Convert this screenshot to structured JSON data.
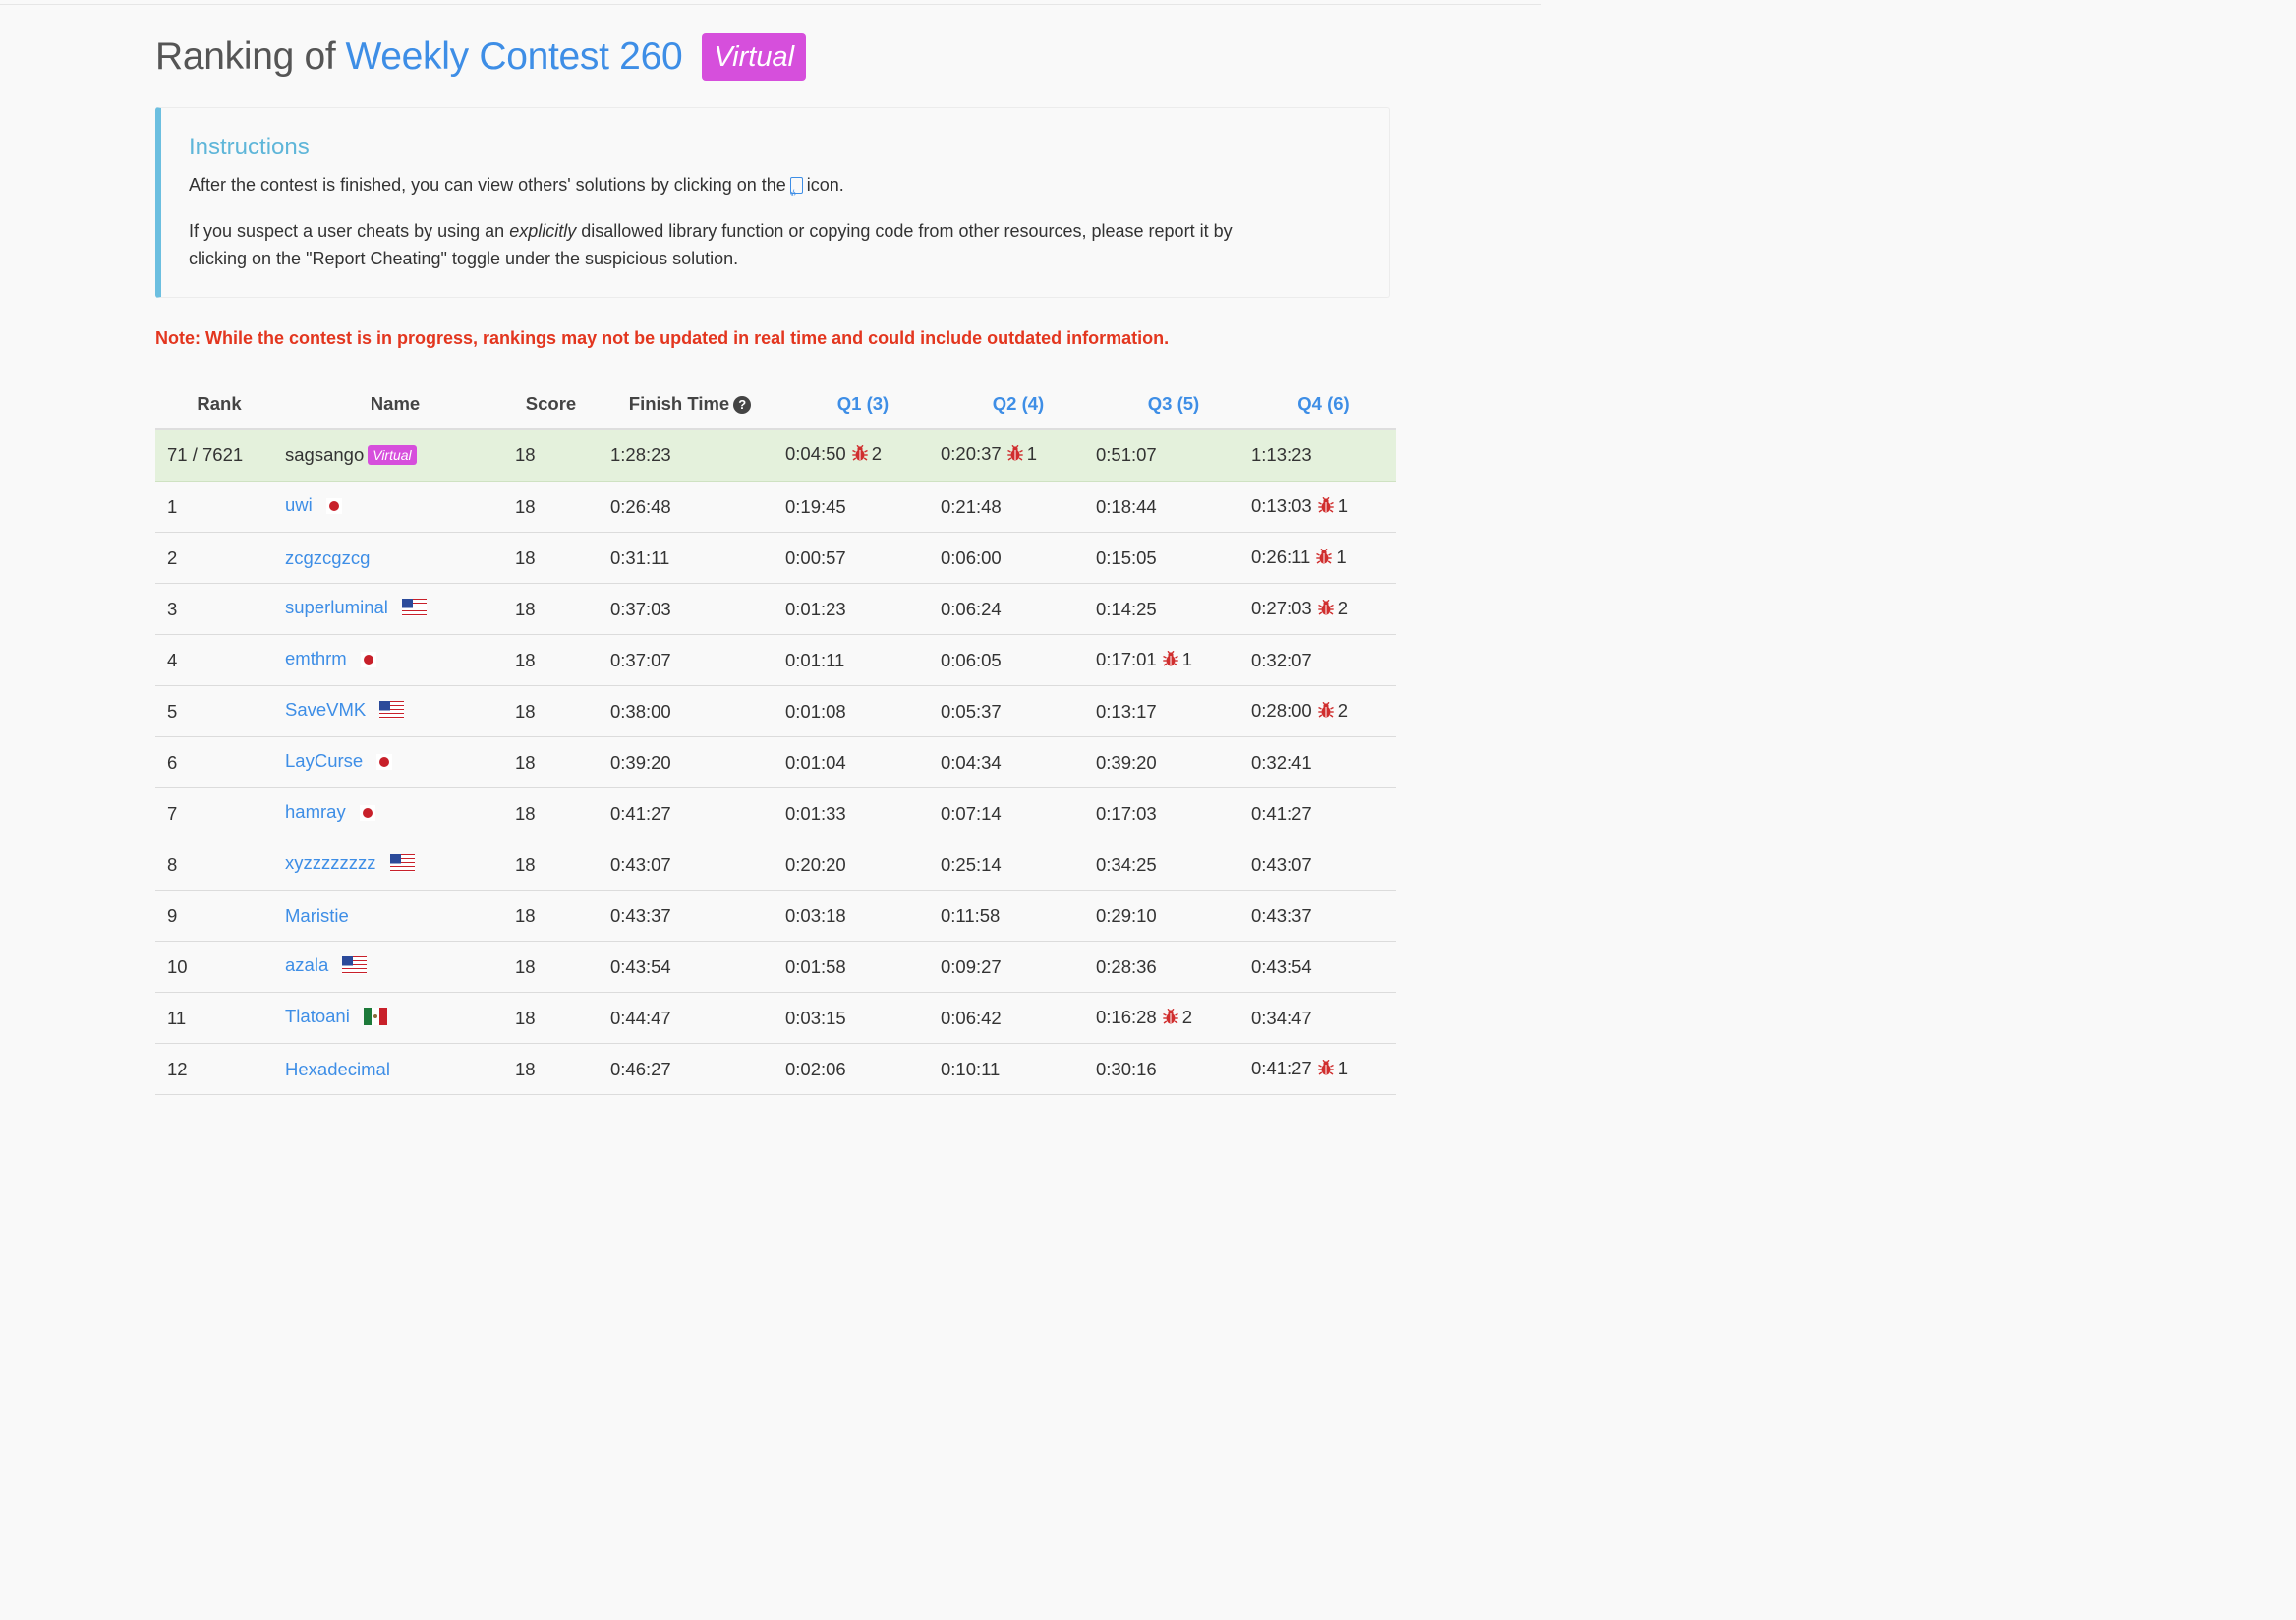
{
  "header": {
    "title_prefix": "Ranking of",
    "contest_name": "Weekly Contest 260",
    "virtual_badge": "Virtual"
  },
  "instructions": {
    "heading": "Instructions",
    "line1_before": "After the contest is finished, you can view others' solutions by clicking on the",
    "line1_after": "icon.",
    "line2_before": "If you suspect a user cheats by using an",
    "line2_emph": "explicitly",
    "line2_after": "disallowed library function or copying code from other resources, please report it by clicking on the \"Report Cheating\" toggle under the suspicious solution."
  },
  "note": "Note: While the contest is in progress, rankings may not be updated in real time and could include outdated information.",
  "table": {
    "headers": {
      "rank": "Rank",
      "name": "Name",
      "score": "Score",
      "finish_time": "Finish Time",
      "q1": "Q1 (3)",
      "q2": "Q2 (4)",
      "q3": "Q3 (5)",
      "q4": "Q4 (6)"
    },
    "rows": [
      {
        "rank": "71 / 7621",
        "name": "sagsango",
        "virtual": "Virtual",
        "flag": "",
        "score": "18",
        "finish": "1:28:23",
        "q": [
          {
            "t": "0:04:50",
            "bugs": "2"
          },
          {
            "t": "0:20:37",
            "bugs": "1"
          },
          {
            "t": "0:51:07",
            "bugs": ""
          },
          {
            "t": "1:13:23",
            "bugs": ""
          }
        ],
        "me": true
      },
      {
        "rank": "1",
        "name": "uwi",
        "flag": "jp",
        "score": "18",
        "finish": "0:26:48",
        "q": [
          {
            "t": "0:19:45",
            "bugs": ""
          },
          {
            "t": "0:21:48",
            "bugs": ""
          },
          {
            "t": "0:18:44",
            "bugs": ""
          },
          {
            "t": "0:13:03",
            "bugs": "1"
          }
        ]
      },
      {
        "rank": "2",
        "name": "zcgzcgzcg",
        "flag": "",
        "score": "18",
        "finish": "0:31:11",
        "q": [
          {
            "t": "0:00:57",
            "bugs": ""
          },
          {
            "t": "0:06:00",
            "bugs": ""
          },
          {
            "t": "0:15:05",
            "bugs": ""
          },
          {
            "t": "0:26:11",
            "bugs": "1"
          }
        ]
      },
      {
        "rank": "3",
        "name": "superluminal",
        "flag": "us",
        "score": "18",
        "finish": "0:37:03",
        "q": [
          {
            "t": "0:01:23",
            "bugs": ""
          },
          {
            "t": "0:06:24",
            "bugs": ""
          },
          {
            "t": "0:14:25",
            "bugs": ""
          },
          {
            "t": "0:27:03",
            "bugs": "2"
          }
        ]
      },
      {
        "rank": "4",
        "name": "emthrm",
        "flag": "jp",
        "score": "18",
        "finish": "0:37:07",
        "q": [
          {
            "t": "0:01:11",
            "bugs": ""
          },
          {
            "t": "0:06:05",
            "bugs": ""
          },
          {
            "t": "0:17:01",
            "bugs": "1"
          },
          {
            "t": "0:32:07",
            "bugs": ""
          }
        ]
      },
      {
        "rank": "5",
        "name": "SaveVMK",
        "flag": "us",
        "score": "18",
        "finish": "0:38:00",
        "q": [
          {
            "t": "0:01:08",
            "bugs": ""
          },
          {
            "t": "0:05:37",
            "bugs": ""
          },
          {
            "t": "0:13:17",
            "bugs": ""
          },
          {
            "t": "0:28:00",
            "bugs": "2"
          }
        ]
      },
      {
        "rank": "6",
        "name": "LayCurse",
        "flag": "jp",
        "score": "18",
        "finish": "0:39:20",
        "q": [
          {
            "t": "0:01:04",
            "bugs": ""
          },
          {
            "t": "0:04:34",
            "bugs": ""
          },
          {
            "t": "0:39:20",
            "bugs": ""
          },
          {
            "t": "0:32:41",
            "bugs": ""
          }
        ]
      },
      {
        "rank": "7",
        "name": "hamray",
        "flag": "jp",
        "score": "18",
        "finish": "0:41:27",
        "q": [
          {
            "t": "0:01:33",
            "bugs": ""
          },
          {
            "t": "0:07:14",
            "bugs": ""
          },
          {
            "t": "0:17:03",
            "bugs": ""
          },
          {
            "t": "0:41:27",
            "bugs": ""
          }
        ]
      },
      {
        "rank": "8",
        "name": "xyzzzzzzzz",
        "flag": "us",
        "score": "18",
        "finish": "0:43:07",
        "q": [
          {
            "t": "0:20:20",
            "bugs": ""
          },
          {
            "t": "0:25:14",
            "bugs": ""
          },
          {
            "t": "0:34:25",
            "bugs": ""
          },
          {
            "t": "0:43:07",
            "bugs": ""
          }
        ]
      },
      {
        "rank": "9",
        "name": "Maristie",
        "flag": "",
        "score": "18",
        "finish": "0:43:37",
        "q": [
          {
            "t": "0:03:18",
            "bugs": ""
          },
          {
            "t": "0:11:58",
            "bugs": ""
          },
          {
            "t": "0:29:10",
            "bugs": ""
          },
          {
            "t": "0:43:37",
            "bugs": ""
          }
        ]
      },
      {
        "rank": "10",
        "name": "azala",
        "flag": "us",
        "score": "18",
        "finish": "0:43:54",
        "q": [
          {
            "t": "0:01:58",
            "bugs": ""
          },
          {
            "t": "0:09:27",
            "bugs": ""
          },
          {
            "t": "0:28:36",
            "bugs": ""
          },
          {
            "t": "0:43:54",
            "bugs": ""
          }
        ]
      },
      {
        "rank": "11",
        "name": "Tlatoani",
        "flag": "mx",
        "score": "18",
        "finish": "0:44:47",
        "q": [
          {
            "t": "0:03:15",
            "bugs": ""
          },
          {
            "t": "0:06:42",
            "bugs": ""
          },
          {
            "t": "0:16:28",
            "bugs": "2"
          },
          {
            "t": "0:34:47",
            "bugs": ""
          }
        ]
      },
      {
        "rank": "12",
        "name": "Hexadecimal",
        "flag": "",
        "score": "18",
        "finish": "0:46:27",
        "q": [
          {
            "t": "0:02:06",
            "bugs": ""
          },
          {
            "t": "0:10:11",
            "bugs": ""
          },
          {
            "t": "0:30:16",
            "bugs": ""
          },
          {
            "t": "0:41:27",
            "bugs": "1"
          }
        ]
      }
    ]
  },
  "icons": {
    "help": "question-circle-icon",
    "code": "code-file-icon",
    "bug": "bug-icon"
  },
  "colors": {
    "link": "#3e8ee6",
    "virtual": "#d64fdc",
    "note": "#e3361f",
    "callout_border": "#6cbfe0",
    "my_row": "#e4f1dc",
    "bug": "#d02e2e"
  }
}
